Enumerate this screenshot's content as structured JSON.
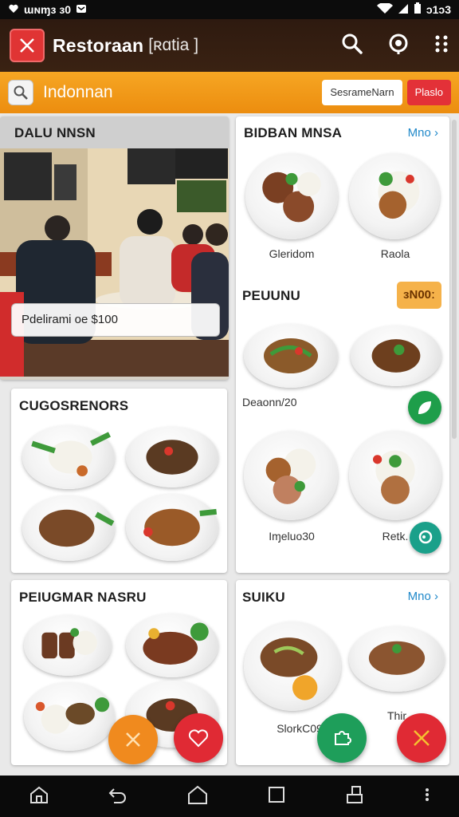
{
  "status_bar": {
    "left_text": "ɯɴɱɜ ɜ0",
    "right_text": "ɔ1ɔ3"
  },
  "app_bar": {
    "title": "Restoraan",
    "subtitle": "[ʀɑtia ]",
    "icons": [
      "close-icon",
      "search-icon",
      "location-icon",
      "more-vert-icon"
    ]
  },
  "search_bar": {
    "query": "Indonnan",
    "button_white": "SesrameNarn",
    "button_red": "Plaslo"
  },
  "cards": {
    "restaurant": {
      "title": "DALU NNSN",
      "price_label": "Pdelirami oe $100"
    },
    "featured": {
      "title": "BIDBAN MNSA",
      "more": "Mno ›",
      "dishes": [
        "Gleridom",
        "Raola"
      ]
    },
    "promo": {
      "title": "PEUUNU",
      "badge": "ɜN00ː",
      "price": "Deaonn/20",
      "dishes": [
        "Iɱeluo30",
        "Retk."
      ]
    },
    "categories": {
      "title": "CUGOSRENORS"
    },
    "popular": {
      "title": "PEIUGMAR NASRU"
    },
    "soup": {
      "title": "SUIKU",
      "more": "Mno ›",
      "dishes": [
        "SlorkC09",
        "Thir"
      ]
    }
  },
  "colors": {
    "accent_orange": "#f09a1a",
    "accent_red": "#e33138",
    "link_blue": "#1f88c9",
    "fab_green": "#1e9e5a",
    "fab_orange": "#f08a1e"
  }
}
